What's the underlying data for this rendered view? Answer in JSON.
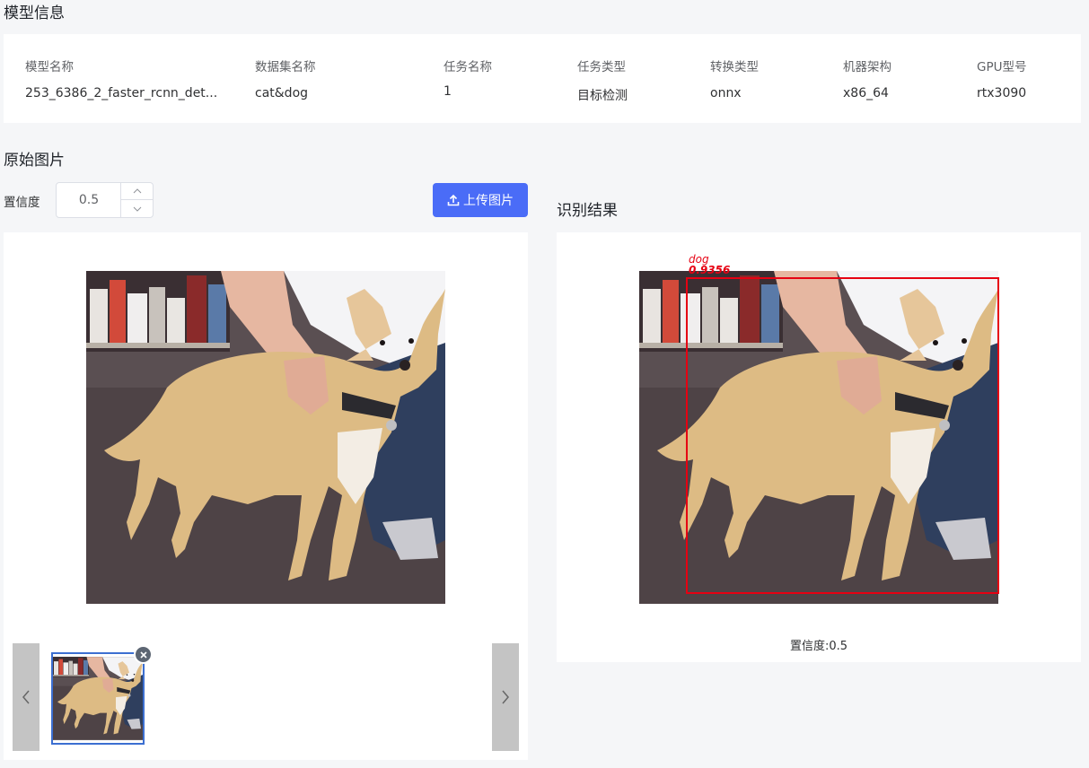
{
  "model_info": {
    "title": "模型信息",
    "columns": [
      {
        "label": "模型名称",
        "value": "253_6386_2_faster_rcnn_det..."
      },
      {
        "label": "数据集名称",
        "value": "cat&dog"
      },
      {
        "label": "任务名称",
        "value": "1"
      },
      {
        "label": "任务类型",
        "value": "目标检测"
      },
      {
        "label": "转换类型",
        "value": "onnx"
      },
      {
        "label": "机器架构",
        "value": "x86_64"
      },
      {
        "label": "GPU型号",
        "value": "rtx3090"
      }
    ]
  },
  "original": {
    "title": "原始图片",
    "confidence_label": "置信度",
    "confidence_value": "0.5",
    "upload_label": "上传图片"
  },
  "result": {
    "title": "识别结果",
    "detection_class": "dog",
    "detection_score": "0.9356",
    "footer": "置信度:0.5"
  },
  "colors": {
    "accent": "#4a6cf7",
    "detection": "#e60012",
    "thumb_border": "#3c6fd1"
  }
}
